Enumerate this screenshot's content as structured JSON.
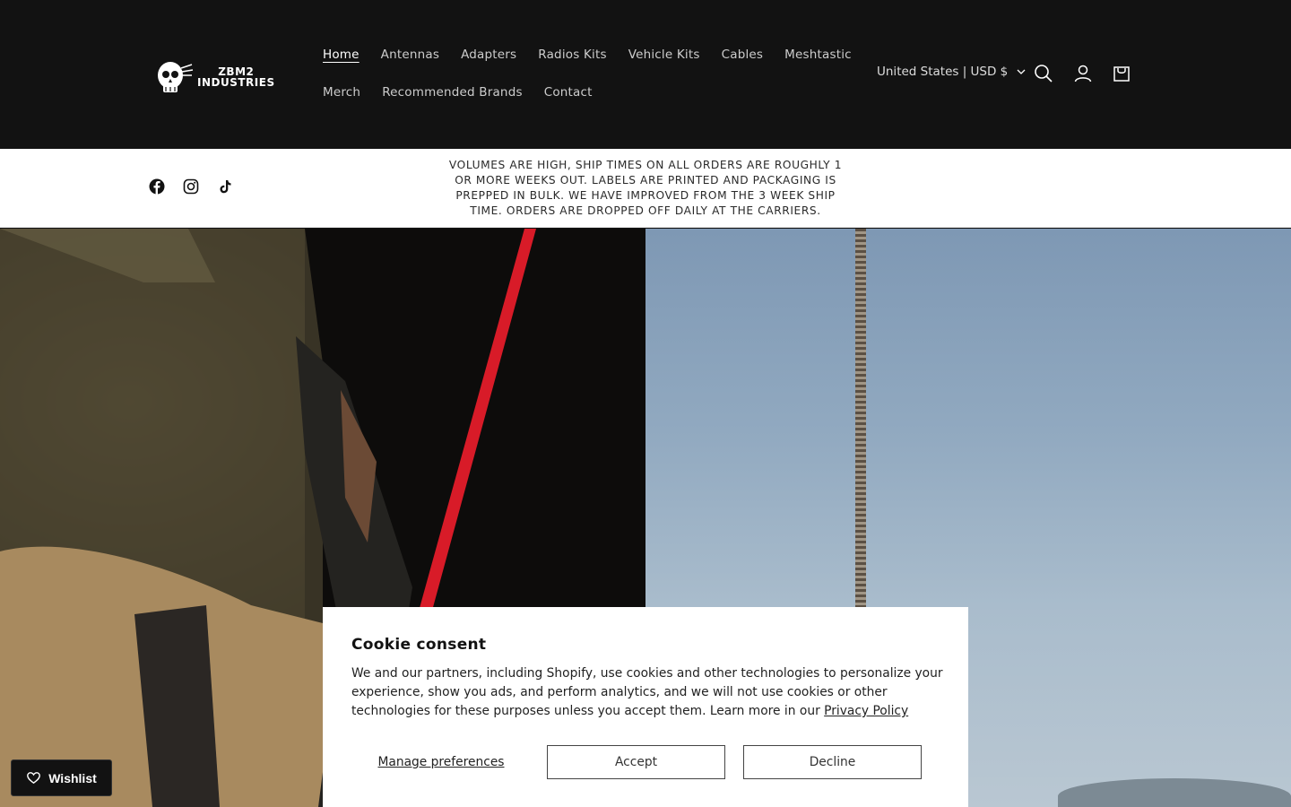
{
  "brand": {
    "line1": "ZBM2",
    "line2": "INDUSTRIES"
  },
  "nav": {
    "row1": [
      {
        "label": "Home",
        "active": true
      },
      {
        "label": "Antennas"
      },
      {
        "label": "Adapters"
      },
      {
        "label": "Radios Kits"
      },
      {
        "label": "Vehicle Kits"
      },
      {
        "label": "Cables"
      },
      {
        "label": "Meshtastic"
      }
    ],
    "row2": [
      {
        "label": "Merch"
      },
      {
        "label": "Recommended Brands"
      },
      {
        "label": "Contact"
      }
    ]
  },
  "header": {
    "country_selector": "United States | USD $",
    "icons": [
      "search-icon",
      "account-icon",
      "cart-icon"
    ]
  },
  "announcement": {
    "text": "VOLUMES ARE HIGH, SHIP TIMES ON ALL ORDERS ARE ROUGHLY 1 OR MORE WEEKS OUT. LABELS ARE PRINTED AND PACKAGING IS PREPPED IN BULK. WE HAVE IMPROVED FROM THE 3 WEEK SHIP TIME. ORDERS ARE DROPPED OFF DAILY AT THE CARRIERS.",
    "socials": [
      "facebook-icon",
      "instagram-icon",
      "tiktok-icon"
    ]
  },
  "cookie": {
    "title": "Cookie consent",
    "body": "We and our partners, including Shopify, use cookies and other technologies to personalize your experience, show you ads, and perform analytics, and we will not use cookies or other technologies for these purposes unless you accept them. Learn more in our ",
    "link": "Privacy Policy",
    "manage": "Manage preferences",
    "accept": "Accept",
    "decline": "Decline"
  },
  "wishlist": {
    "label": "Wishlist"
  },
  "colors": {
    "header_bg": "#121212",
    "announce_bg": "#ffffff",
    "antenna_red": "#d81b28"
  }
}
